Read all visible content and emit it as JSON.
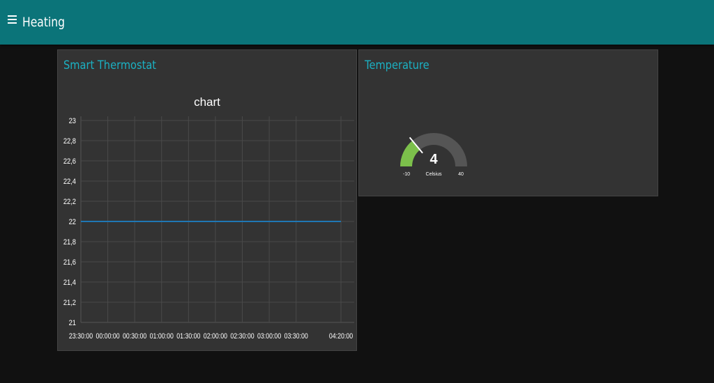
{
  "app": {
    "menu_icon": "hamburger-menu-icon",
    "title": "Heating",
    "accent_color": "#0b7479",
    "title_color": "#1bb1c3"
  },
  "widgets": {
    "chart_group_title": "Smart Thermostat",
    "gauge_group_title": "Temperature"
  },
  "gauge": {
    "value": "4",
    "min": "-10",
    "max": "40",
    "units": "Celsius",
    "fill_color": "#7cc04b",
    "track_color": "#555555"
  },
  "chart_data": {
    "type": "line",
    "title": "chart",
    "xlabel": "",
    "ylabel": "",
    "ylim": [
      21,
      23
    ],
    "yticks": [
      "23",
      "22,8",
      "22,6",
      "22,4",
      "22,2",
      "22",
      "21,8",
      "21,6",
      "21,4",
      "21,2",
      "21"
    ],
    "xticks": [
      "23:30:00",
      "00:00:00",
      "00:30:00",
      "01:00:00",
      "01:30:00",
      "02:00:00",
      "02:30:00",
      "03:00:00",
      "03:30:00",
      "04:20:00"
    ],
    "xlim": [
      "23:30:00",
      "04:20:00"
    ],
    "grid": true,
    "series": [
      {
        "color": "#1f77b4",
        "x": [
          "23:30:00",
          "04:20:00"
        ],
        "values": [
          22,
          22
        ]
      }
    ]
  }
}
